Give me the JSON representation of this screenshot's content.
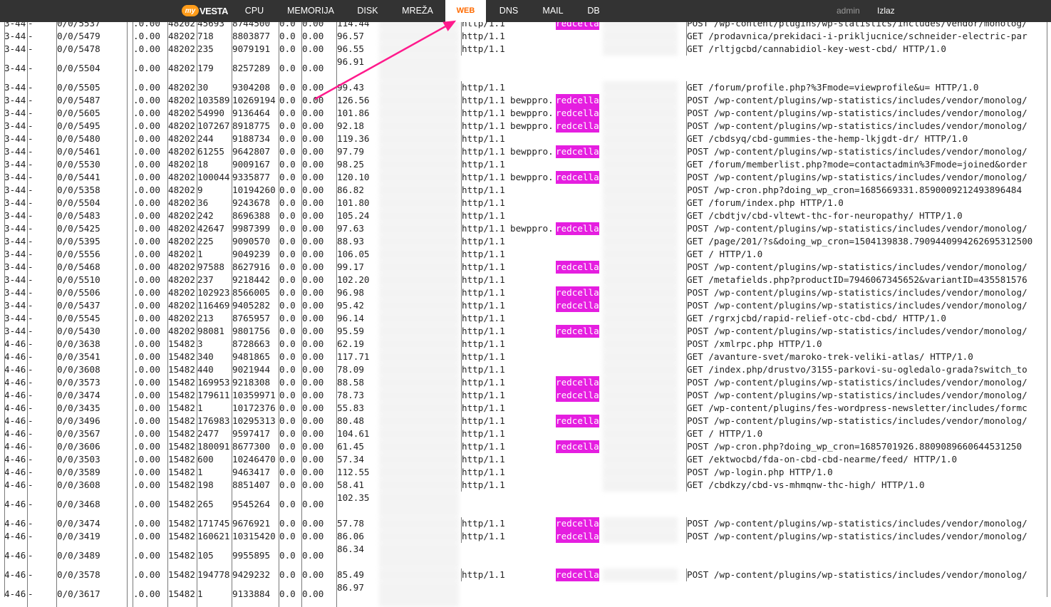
{
  "app": {
    "logo_badge": "my",
    "logo_word": "VESTA"
  },
  "nav": [
    {
      "label": "CPU",
      "active": false
    },
    {
      "label": "MEMORIJA",
      "active": false
    },
    {
      "label": "DISK",
      "active": false
    },
    {
      "label": "MREŽA",
      "active": false
    },
    {
      "label": "WEB",
      "active": true
    },
    {
      "label": "DNS",
      "active": false
    },
    {
      "label": "MAIL",
      "active": false
    },
    {
      "label": "DB",
      "active": false
    }
  ],
  "user": {
    "name": "admin",
    "logout": "Izlaz"
  },
  "colors": {
    "topbar": "#333333",
    "active_tab_text": "#ff6a00",
    "highlight": "#e51ee0",
    "arrow": "#ff1a8c"
  },
  "status_rows": [
    {
      "srv": "3-44",
      "m": "-",
      "pid": "0/0/5537",
      "cpu": ".0.00",
      "acc": "48202",
      "bytes": "45693",
      "ss": "8744500",
      "req": "0.0",
      "conn": "0.00",
      "time": "114.44",
      "proto": "http/1.1",
      "vhost": "",
      "hl": "redcella",
      "request": "POST /wp-content/plugins/wp-statistics/includes/vendor/monolog/"
    },
    {
      "srv": "3-44",
      "m": "-",
      "pid": "0/0/5479",
      "cpu": ".0.00",
      "acc": "48202",
      "bytes": "718",
      "ss": "8803877",
      "req": "0.0",
      "conn": "0.00",
      "time": "96.57",
      "proto": "http/1.1",
      "vhost": "",
      "hl": "",
      "request": "GET /prodavnica/prekidaci-i-prikljucnice/schneider-electric-par"
    },
    {
      "srv": "3-44",
      "m": "-",
      "pid": "0/0/5478",
      "cpu": ".0.00",
      "acc": "48202",
      "bytes": "235",
      "ss": "9079191",
      "req": "0.0",
      "conn": "0.00",
      "time": "96.55",
      "proto": "http/1.1",
      "vhost": "",
      "hl": "",
      "request": "GET /rltjgcbd/cannabidiol-key-west-cbd/ HTTP/1.0"
    },
    {
      "srv": "3-44",
      "m": "-",
      "pid": "0/0/5504",
      "cpu": ".0.00",
      "acc": "48202",
      "bytes": "179",
      "ss": "8257289",
      "req": "0.0",
      "conn": "0.00",
      "time": "96.91",
      "proto": "",
      "vhost": "",
      "hl": "",
      "request": "",
      "tall": true
    },
    {
      "srv": "3-44",
      "m": "-",
      "pid": "0/0/5505",
      "cpu": ".0.00",
      "acc": "48202",
      "bytes": "30",
      "ss": "9304208",
      "req": "0.0",
      "conn": "0.00",
      "time": "99.43",
      "proto": "http/1.1",
      "vhost": "",
      "hl": "",
      "request": "GET /forum/profile.php?%3Fmode=viewprofile&u= HTTP/1.0"
    },
    {
      "srv": "3-44",
      "m": "-",
      "pid": "0/0/5487",
      "cpu": ".0.00",
      "acc": "48202",
      "bytes": "103589",
      "ss": "10269194",
      "req": "0.0",
      "conn": "0.00",
      "time": "126.56",
      "proto": "http/1.1",
      "vhost": "bewppro.",
      "hl": "redcella",
      "request": "POST /wp-content/plugins/wp-statistics/includes/vendor/monolog/"
    },
    {
      "srv": "3-44",
      "m": "-",
      "pid": "0/0/5605",
      "cpu": ".0.00",
      "acc": "48202",
      "bytes": "54990",
      "ss": "9136464",
      "req": "0.0",
      "conn": "0.00",
      "time": "101.86",
      "proto": "http/1.1",
      "vhost": "bewppro.",
      "hl": "redcella",
      "request": "POST /wp-content/plugins/wp-statistics/includes/vendor/monolog/"
    },
    {
      "srv": "3-44",
      "m": "-",
      "pid": "0/0/5495",
      "cpu": ".0.00",
      "acc": "48202",
      "bytes": "107267",
      "ss": "8918775",
      "req": "0.0",
      "conn": "0.00",
      "time": "92.18",
      "proto": "http/1.1",
      "vhost": "bewppro.",
      "hl": "redcella",
      "request": "POST /wp-content/plugins/wp-statistics/includes/vendor/monolog/"
    },
    {
      "srv": "3-44",
      "m": "-",
      "pid": "0/0/5480",
      "cpu": ".0.00",
      "acc": "48202",
      "bytes": "244",
      "ss": "9188734",
      "req": "0.0",
      "conn": "0.00",
      "time": "119.36",
      "proto": "http/1.1",
      "vhost": "",
      "hl": "",
      "request": "GET /cbdsyq/cbd-gummies-the-hemp-lkjgdt-dr/ HTTP/1.0"
    },
    {
      "srv": "3-44",
      "m": "-",
      "pid": "0/0/5461",
      "cpu": ".0.00",
      "acc": "48202",
      "bytes": "61255",
      "ss": "9642807",
      "req": "0.0",
      "conn": "0.00",
      "time": "97.79",
      "proto": "http/1.1",
      "vhost": "bewppro.",
      "hl": "redcella",
      "request": "POST /wp-content/plugins/wp-statistics/includes/vendor/monolog/"
    },
    {
      "srv": "3-44",
      "m": "-",
      "pid": "0/0/5530",
      "cpu": ".0.00",
      "acc": "48202",
      "bytes": "18",
      "ss": "9009167",
      "req": "0.0",
      "conn": "0.00",
      "time": "98.25",
      "proto": "http/1.1",
      "vhost": "",
      "hl": "",
      "request": "GET /forum/memberlist.php?mode=contactadmin%3Fmode=joined&order"
    },
    {
      "srv": "3-44",
      "m": "-",
      "pid": "0/0/5441",
      "cpu": ".0.00",
      "acc": "48202",
      "bytes": "100044",
      "ss": "9335877",
      "req": "0.0",
      "conn": "0.00",
      "time": "120.10",
      "proto": "http/1.1",
      "vhost": "bewppro.",
      "hl": "redcella",
      "request": "POST /wp-content/plugins/wp-statistics/includes/vendor/monolog/"
    },
    {
      "srv": "3-44",
      "m": "-",
      "pid": "0/0/5358",
      "cpu": ".0.00",
      "acc": "48202",
      "bytes": "9",
      "ss": "10194260",
      "req": "0.0",
      "conn": "0.00",
      "time": "86.82",
      "proto": "http/1.1",
      "vhost": "",
      "hl": "",
      "request": "POST /wp-cron.php?doing_wp_cron=1685669331.8590009212493896484"
    },
    {
      "srv": "3-44",
      "m": "-",
      "pid": "0/0/5504",
      "cpu": ".0.00",
      "acc": "48202",
      "bytes": "36",
      "ss": "9243678",
      "req": "0.0",
      "conn": "0.00",
      "time": "101.80",
      "proto": "http/1.1",
      "vhost": "",
      "hl": "",
      "request": "GET /forum/index.php HTTP/1.0"
    },
    {
      "srv": "3-44",
      "m": "-",
      "pid": "0/0/5483",
      "cpu": ".0.00",
      "acc": "48202",
      "bytes": "242",
      "ss": "8696388",
      "req": "0.0",
      "conn": "0.00",
      "time": "105.24",
      "proto": "http/1.1",
      "vhost": "",
      "hl": "",
      "request": "GET /cbdtjv/cbd-vltewt-thc-for-neuropathy/ HTTP/1.0"
    },
    {
      "srv": "3-44",
      "m": "-",
      "pid": "0/0/5425",
      "cpu": ".0.00",
      "acc": "48202",
      "bytes": "42647",
      "ss": "9987399",
      "req": "0.0",
      "conn": "0.00",
      "time": "97.63",
      "proto": "http/1.1",
      "vhost": "bewppro.",
      "hl": "redcella",
      "request": "POST /wp-content/plugins/wp-statistics/includes/vendor/monolog/"
    },
    {
      "srv": "3-44",
      "m": "-",
      "pid": "0/0/5395",
      "cpu": ".0.00",
      "acc": "48202",
      "bytes": "225",
      "ss": "9090570",
      "req": "0.0",
      "conn": "0.00",
      "time": "88.93",
      "proto": "http/1.1",
      "vhost": "",
      "hl": "",
      "request": "GET /page/201/?s&doing_wp_cron=1504139838.7909440994262695312500"
    },
    {
      "srv": "3-44",
      "m": "-",
      "pid": "0/0/5556",
      "cpu": ".0.00",
      "acc": "48202",
      "bytes": "1",
      "ss": "9049239",
      "req": "0.0",
      "conn": "0.00",
      "time": "106.05",
      "proto": "http/1.1",
      "vhost": "",
      "hl": "",
      "request": "GET / HTTP/1.0"
    },
    {
      "srv": "3-44",
      "m": "-",
      "pid": "0/0/5468",
      "cpu": ".0.00",
      "acc": "48202",
      "bytes": "97588",
      "ss": "8627916",
      "req": "0.0",
      "conn": "0.00",
      "time": "99.17",
      "proto": "http/1.1",
      "vhost": "",
      "hl": "redcella",
      "request": "POST /wp-content/plugins/wp-statistics/includes/vendor/monolog/"
    },
    {
      "srv": "3-44",
      "m": "-",
      "pid": "0/0/5510",
      "cpu": ".0.00",
      "acc": "48202",
      "bytes": "237",
      "ss": "9218442",
      "req": "0.0",
      "conn": "0.00",
      "time": "102.20",
      "proto": "http/1.1",
      "vhost": "",
      "hl": "",
      "request": "GET /metafields.php?productID=7946067345652&variantID=435581576"
    },
    {
      "srv": "3-44",
      "m": "-",
      "pid": "0/0/5506",
      "cpu": ".0.00",
      "acc": "48202",
      "bytes": "102923",
      "ss": "8566005",
      "req": "0.0",
      "conn": "0.00",
      "time": "96.98",
      "proto": "http/1.1",
      "vhost": "",
      "hl": "redcella",
      "request": "POST /wp-content/plugins/wp-statistics/includes/vendor/monolog/"
    },
    {
      "srv": "3-44",
      "m": "-",
      "pid": "0/0/5437",
      "cpu": ".0.00",
      "acc": "48202",
      "bytes": "116469",
      "ss": "9405282",
      "req": "0.0",
      "conn": "0.00",
      "time": "95.42",
      "proto": "http/1.1",
      "vhost": "",
      "hl": "redcella",
      "request": "POST /wp-content/plugins/wp-statistics/includes/vendor/monolog/"
    },
    {
      "srv": "3-44",
      "m": "-",
      "pid": "0/0/5545",
      "cpu": ".0.00",
      "acc": "48202",
      "bytes": "213",
      "ss": "8765957",
      "req": "0.0",
      "conn": "0.00",
      "time": "96.14",
      "proto": "http/1.1",
      "vhost": "",
      "hl": "",
      "request": "GET /rgrxjcbd/rapid-relief-otc-cbd-cbd/ HTTP/1.0"
    },
    {
      "srv": "3-44",
      "m": "-",
      "pid": "0/0/5430",
      "cpu": ".0.00",
      "acc": "48202",
      "bytes": "98081",
      "ss": "9801756",
      "req": "0.0",
      "conn": "0.00",
      "time": "95.59",
      "proto": "http/1.1",
      "vhost": "",
      "hl": "redcella",
      "request": "POST /wp-content/plugins/wp-statistics/includes/vendor/monolog/"
    },
    {
      "srv": "4-46",
      "m": "-",
      "pid": "0/0/3638",
      "cpu": ".0.00",
      "acc": "15482",
      "bytes": "3",
      "ss": "8728663",
      "req": "0.0",
      "conn": "0.00",
      "time": "62.19",
      "proto": "http/1.1",
      "vhost": "",
      "hl": "",
      "request": "POST /xmlrpc.php HTTP/1.0"
    },
    {
      "srv": "4-46",
      "m": "-",
      "pid": "0/0/3541",
      "cpu": ".0.00",
      "acc": "15482",
      "bytes": "340",
      "ss": "9481865",
      "req": "0.0",
      "conn": "0.00",
      "time": "117.71",
      "proto": "http/1.1",
      "vhost": "",
      "hl": "",
      "request": "GET /avanture-svet/maroko-trek-veliki-atlas/ HTTP/1.0"
    },
    {
      "srv": "4-46",
      "m": "-",
      "pid": "0/0/3608",
      "cpu": ".0.00",
      "acc": "15482",
      "bytes": "440",
      "ss": "9021944",
      "req": "0.0",
      "conn": "0.00",
      "time": "78.09",
      "proto": "http/1.1",
      "vhost": "",
      "hl": "",
      "request": "GET /index.php/drustvo/3155-parkovi-su-ogledalo-grada?switch_to"
    },
    {
      "srv": "4-46",
      "m": "-",
      "pid": "0/0/3573",
      "cpu": ".0.00",
      "acc": "15482",
      "bytes": "169953",
      "ss": "9218308",
      "req": "0.0",
      "conn": "0.00",
      "time": "88.58",
      "proto": "http/1.1",
      "vhost": "",
      "hl": "redcella",
      "request": "POST /wp-content/plugins/wp-statistics/includes/vendor/monolog/"
    },
    {
      "srv": "4-46",
      "m": "-",
      "pid": "0/0/3474",
      "cpu": ".0.00",
      "acc": "15482",
      "bytes": "179611",
      "ss": "10359971",
      "req": "0.0",
      "conn": "0.00",
      "time": "78.73",
      "proto": "http/1.1",
      "vhost": "",
      "hl": "redcella",
      "request": "POST /wp-content/plugins/wp-statistics/includes/vendor/monolog/"
    },
    {
      "srv": "4-46",
      "m": "-",
      "pid": "0/0/3435",
      "cpu": ".0.00",
      "acc": "15482",
      "bytes": "1",
      "ss": "10172376",
      "req": "0.0",
      "conn": "0.00",
      "time": "55.83",
      "proto": "http/1.1",
      "vhost": "",
      "hl": "",
      "request": "GET /wp-content/plugins/fes-wordpress-newsletter/includes/formc"
    },
    {
      "srv": "4-46",
      "m": "-",
      "pid": "0/0/3496",
      "cpu": ".0.00",
      "acc": "15482",
      "bytes": "176983",
      "ss": "10295313",
      "req": "0.0",
      "conn": "0.00",
      "time": "80.48",
      "proto": "http/1.1",
      "vhost": "",
      "hl": "redcella",
      "request": "POST /wp-content/plugins/wp-statistics/includes/vendor/monolog/"
    },
    {
      "srv": "4-46",
      "m": "-",
      "pid": "0/0/3567",
      "cpu": ".0.00",
      "acc": "15482",
      "bytes": "2477",
      "ss": "9597417",
      "req": "0.0",
      "conn": "0.00",
      "time": "104.61",
      "proto": "http/1.1",
      "vhost": "",
      "hl": "",
      "request": "GET / HTTP/1.0"
    },
    {
      "srv": "4-46",
      "m": "-",
      "pid": "0/0/3606",
      "cpu": ".0.00",
      "acc": "15482",
      "bytes": "180091",
      "ss": "8677300",
      "req": "0.0",
      "conn": "0.00",
      "time": "61.45",
      "proto": "http/1.1",
      "vhost": "",
      "hl": "redcella",
      "request": "POST /wp-cron.php?doing_wp_cron=1685701926.8809089660644531250"
    },
    {
      "srv": "4-46",
      "m": "-",
      "pid": "0/0/3503",
      "cpu": ".0.00",
      "acc": "15482",
      "bytes": "600",
      "ss": "10246470",
      "req": "0.0",
      "conn": "0.00",
      "time": "57.34",
      "proto": "http/1.1",
      "vhost": "",
      "hl": "",
      "request": "GET /ektwocbd/fda-on-cbd-cbd-nearme/feed/ HTTP/1.0"
    },
    {
      "srv": "4-46",
      "m": "-",
      "pid": "0/0/3589",
      "cpu": ".0.00",
      "acc": "15482",
      "bytes": "1",
      "ss": "9463417",
      "req": "0.0",
      "conn": "0.00",
      "time": "112.55",
      "proto": "http/1.1",
      "vhost": "",
      "hl": "",
      "request": "POST /wp-login.php HTTP/1.0"
    },
    {
      "srv": "4-46",
      "m": "-",
      "pid": "0/0/3608",
      "cpu": ".0.00",
      "acc": "15482",
      "bytes": "198",
      "ss": "8851407",
      "req": "0.0",
      "conn": "0.00",
      "time": "58.41",
      "proto": "http/1.1",
      "vhost": "",
      "hl": "",
      "request": "GET /cbdkzy/cbd-vs-mhmqnw-thc-high/ HTTP/1.0"
    },
    {
      "srv": "4-46",
      "m": "-",
      "pid": "0/0/3468",
      "cpu": ".0.00",
      "acc": "15482",
      "bytes": "265",
      "ss": "9545264",
      "req": "0.0",
      "conn": "0.00",
      "time": "102.35",
      "proto": "",
      "vhost": "",
      "hl": "",
      "request": "",
      "tall": true
    },
    {
      "srv": "4-46",
      "m": "-",
      "pid": "0/0/3474",
      "cpu": ".0.00",
      "acc": "15482",
      "bytes": "171745",
      "ss": "9676921",
      "req": "0.0",
      "conn": "0.00",
      "time": "57.78",
      "proto": "http/1.1",
      "vhost": "",
      "hl": "redcella",
      "request": "POST /wp-content/plugins/wp-statistics/includes/vendor/monolog/"
    },
    {
      "srv": "4-46",
      "m": "-",
      "pid": "0/0/3419",
      "cpu": ".0.00",
      "acc": "15482",
      "bytes": "160621",
      "ss": "10315420",
      "req": "0.0",
      "conn": "0.00",
      "time": "86.06",
      "proto": "http/1.1",
      "vhost": "",
      "hl": "redcella",
      "request": "POST /wp-content/plugins/wp-statistics/includes/vendor/monolog/"
    },
    {
      "srv": "4-46",
      "m": "-",
      "pid": "0/0/3489",
      "cpu": ".0.00",
      "acc": "15482",
      "bytes": "105",
      "ss": "9955895",
      "req": "0.0",
      "conn": "0.00",
      "time": "86.34",
      "proto": "",
      "vhost": "",
      "hl": "",
      "request": "",
      "tall": true
    },
    {
      "srv": "4-46",
      "m": "-",
      "pid": "0/0/3578",
      "cpu": ".0.00",
      "acc": "15482",
      "bytes": "194778",
      "ss": "9429232",
      "req": "0.0",
      "conn": "0.00",
      "time": "85.49",
      "proto": "http/1.1",
      "vhost": "",
      "hl": "redcella",
      "request": "POST /wp-content/plugins/wp-statistics/includes/vendor/monolog/"
    },
    {
      "srv": "4-46",
      "m": "-",
      "pid": "0/0/3617",
      "cpu": ".0.00",
      "acc": "15482",
      "bytes": "1",
      "ss": "9133884",
      "req": "0.0",
      "conn": "0.00",
      "time": "86.97",
      "proto": "",
      "vhost": "",
      "hl": "",
      "request": "",
      "tall": true
    }
  ]
}
